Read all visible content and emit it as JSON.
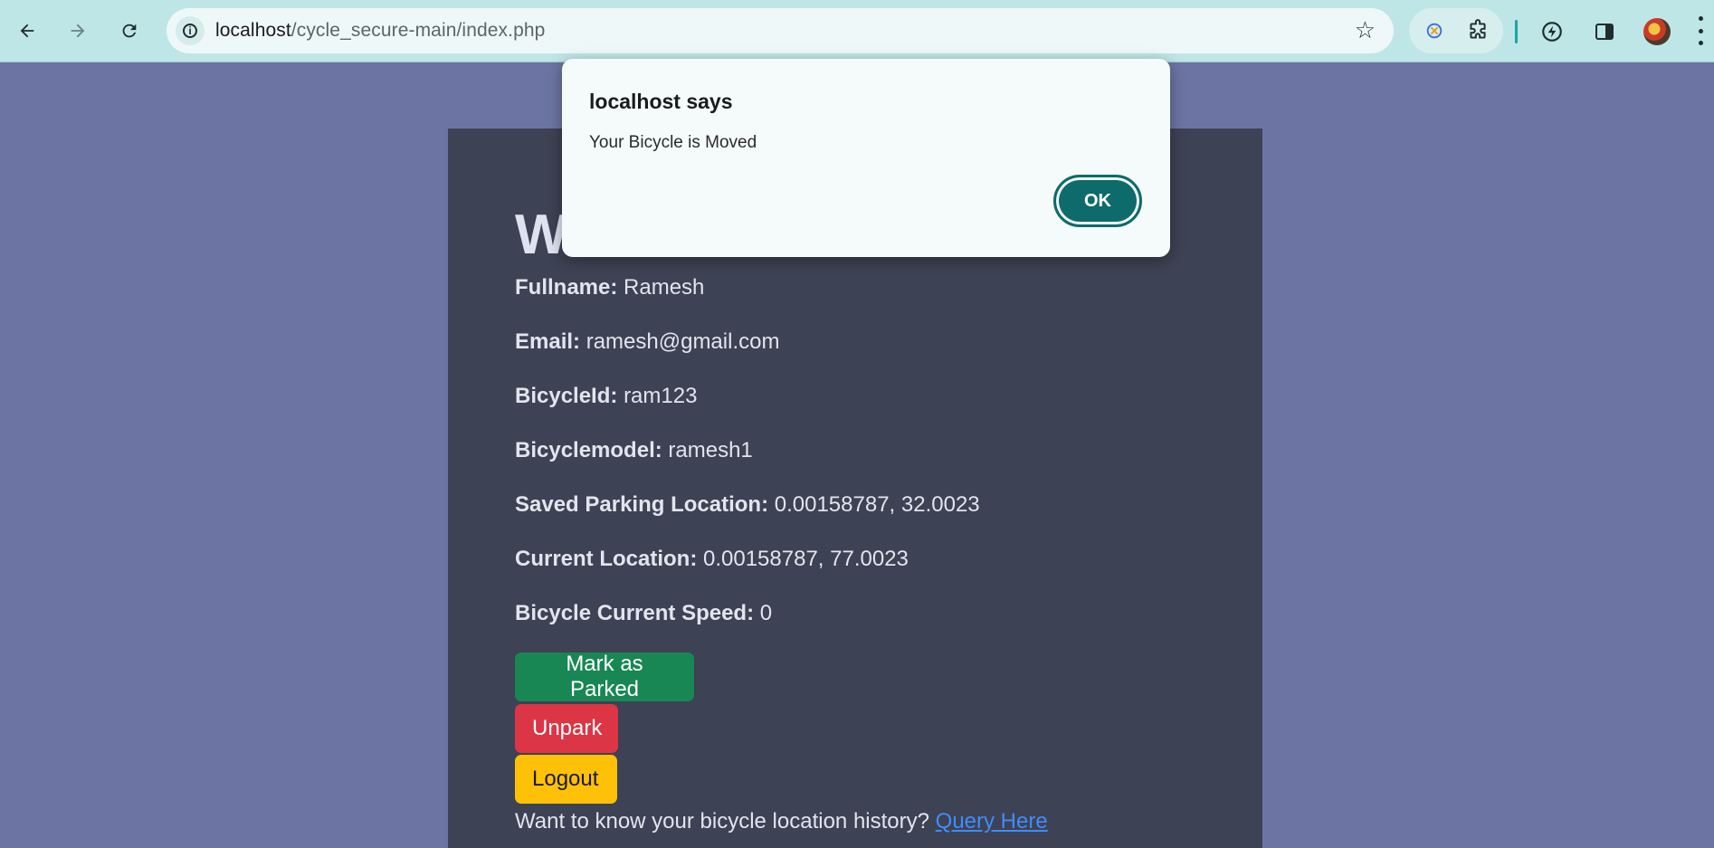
{
  "browser": {
    "url_host": "localhost",
    "url_path": "/cycle_secure-main/index.php"
  },
  "dialog": {
    "title": "localhost says",
    "message": "Your Bicycle is Moved",
    "ok_label": "OK"
  },
  "page": {
    "heading": "W",
    "fields": [
      {
        "label": "Fullname:",
        "value": "Ramesh"
      },
      {
        "label": "Email:",
        "value": "ramesh@gmail.com"
      },
      {
        "label": "BicycleId:",
        "value": "ram123"
      },
      {
        "label": "Bicyclemodel:",
        "value": "ramesh1"
      },
      {
        "label": "Saved Parking Location:",
        "value": "0.00158787, 32.0023"
      },
      {
        "label": "Current Location:",
        "value": "0.00158787, 77.0023"
      },
      {
        "label": "Bicycle Current Speed:",
        "value": "0"
      }
    ],
    "buttons": {
      "mark_parked": "Mark as Parked",
      "unpark": "Unpark",
      "logout": "Logout"
    },
    "history_text": "Want to know your bicycle location history?",
    "history_link": "Query Here"
  },
  "colors": {
    "background": "#6c74a3",
    "card": "#3d4254",
    "success": "#198754",
    "danger": "#dc3545",
    "warning": "#ffc107",
    "dialog_accent": "#0e6b6b"
  }
}
